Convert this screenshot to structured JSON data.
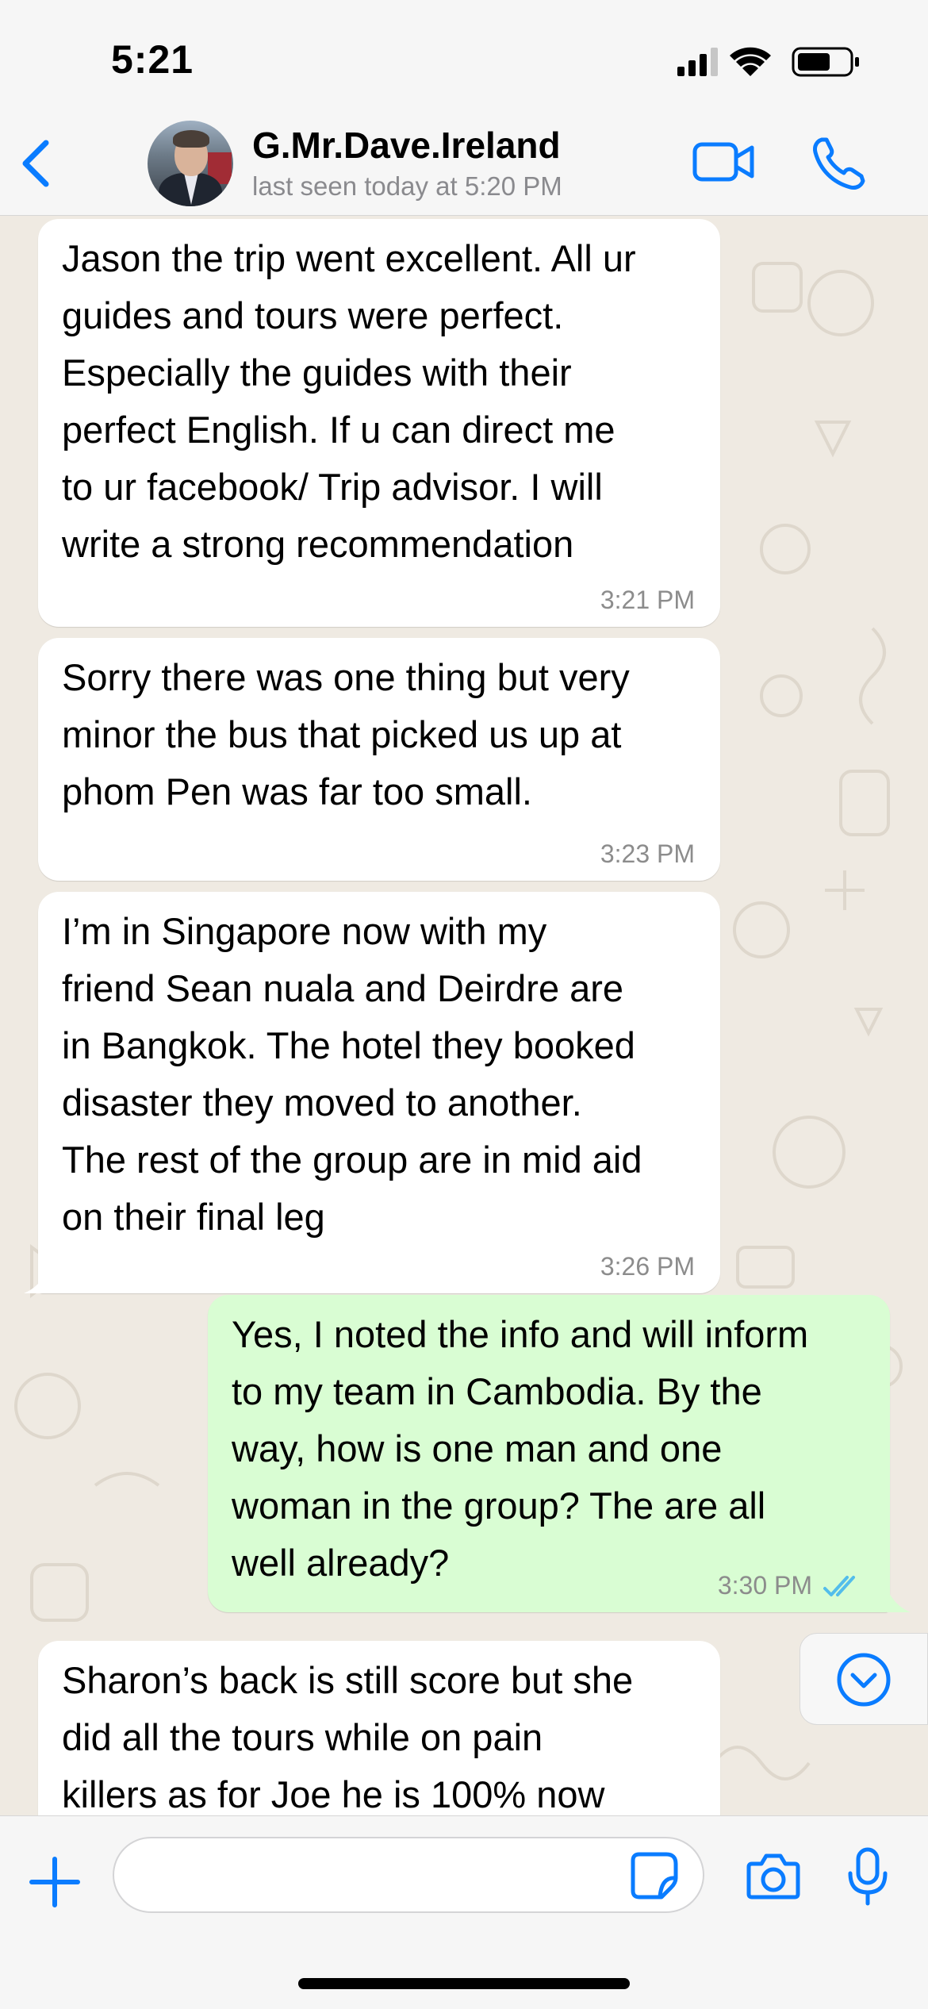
{
  "status_bar": {
    "time": "5:21",
    "icons": [
      "signal-icon",
      "wifi-icon",
      "battery-icon"
    ]
  },
  "header": {
    "back_icon": "chevron-left-icon",
    "contact_name": "G.Mr.Dave.Ireland",
    "last_seen": "last seen today at 5:20 PM",
    "actions": [
      "video-call-icon",
      "phone-call-icon"
    ],
    "accent_color": "#0a7cff"
  },
  "messages": [
    {
      "direction": "incoming",
      "text": "Jason the trip went excellent. All ur\nguides and tours were perfect.\nEspecially the guides with their\nperfect English. If u can direct me\nto ur facebook/ Trip advisor. I will\nwrite a strong recommendation",
      "time": "3:21 PM"
    },
    {
      "direction": "incoming",
      "text": "Sorry there was one thing but very\nminor the bus that picked us up at\nphom Pen was far too small.",
      "time": "3:23 PM"
    },
    {
      "direction": "incoming",
      "text": "I’m in Singapore now with my\nfriend Sean nuala and Deirdre are\nin Bangkok. The hotel they booked\ndisaster they moved to another.\nThe rest of the group are in mid aid\non their final leg",
      "time": "3:26 PM"
    },
    {
      "direction": "outgoing",
      "text": "Yes, I noted the info and will inform\nto my team in Cambodia. By the\nway, how is one man and one\nwoman in the group? The are all\nwell already?",
      "time": "3:30 PM",
      "status": "read"
    },
    {
      "direction": "incoming",
      "text": "Sharon’s back is still score but she\ndid all the tours while on pain\nkillers as for Joe he is 100% now",
      "time": ""
    }
  ],
  "colors": {
    "chat_background": "#efeae2",
    "incoming_bubble": "#ffffff",
    "outgoing_bubble": "#d9fdd3",
    "read_ticks": "#53bdeb"
  },
  "composer": {
    "value": "",
    "placeholder": "",
    "icons": [
      "plus-icon",
      "sticker-icon",
      "camera-icon",
      "microphone-icon"
    ]
  }
}
